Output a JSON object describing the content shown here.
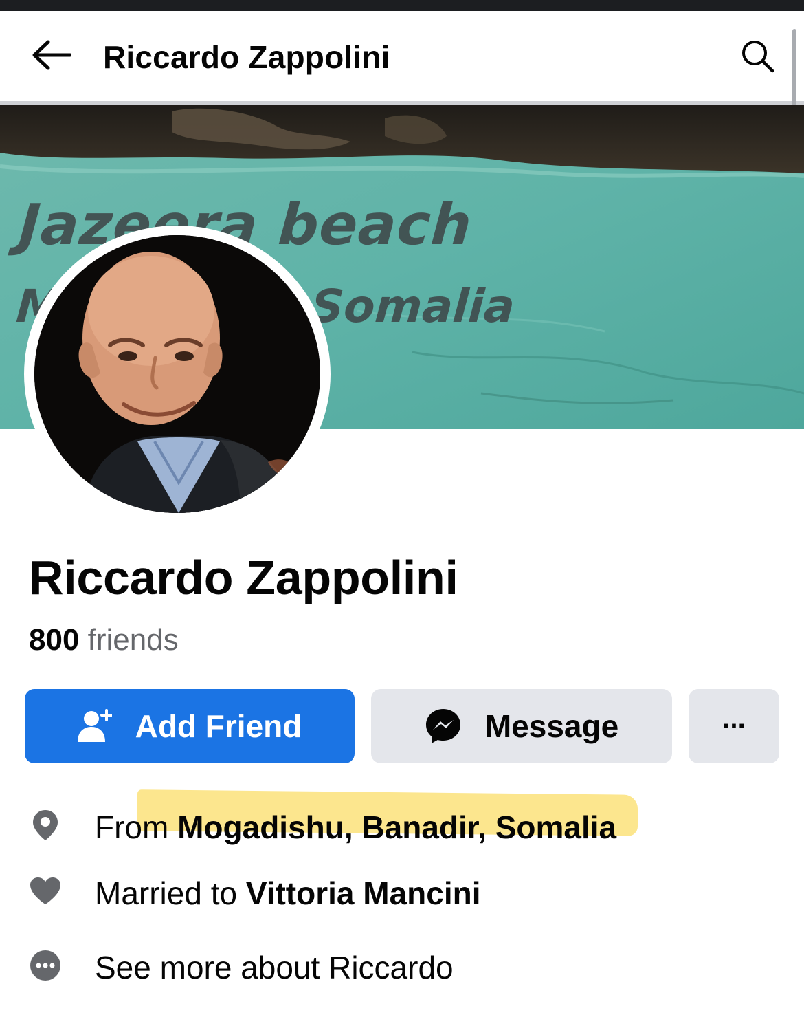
{
  "topbar": {
    "title": "Riccardo Zappolini"
  },
  "cover": {
    "line1": "Jazeera beach",
    "line2": "Mogadishu Somalia"
  },
  "profile": {
    "name": "Riccardo Zappolini",
    "friend_count": "800",
    "friends_label": "friends"
  },
  "actions": {
    "add_friend_label": "Add Friend",
    "message_label": "Message",
    "more_label": "···"
  },
  "details": [
    {
      "icon": "location-pin-icon",
      "prefix": "From ",
      "value": "Mogadishu, Banadir, Somalia"
    },
    {
      "icon": "heart-icon",
      "prefix": "Married to ",
      "value": "Vittoria Mancini"
    },
    {
      "icon": "more-dots-icon",
      "text": "See more about Riccardo"
    }
  ],
  "colors": {
    "primary_blue": "#1b74e4",
    "secondary_gray": "#e4e6eb",
    "highlight": "#fbe27a",
    "icon_gray": "#65676b"
  }
}
